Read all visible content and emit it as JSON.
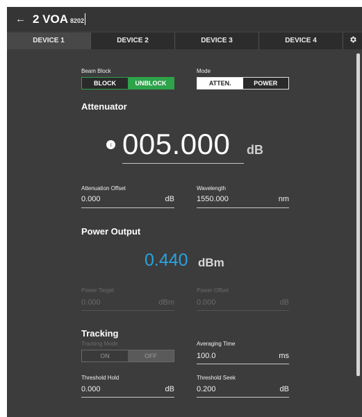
{
  "window": {
    "back_icon": "←",
    "title_main": "2 VOA",
    "title_sub": "8202"
  },
  "tabs": {
    "items": [
      "DEVICE 1",
      "DEVICE 2",
      "DEVICE 3",
      "DEVICE 4"
    ],
    "active": "DEVICE 1",
    "settings_icon": "gear-icon"
  },
  "beam_block": {
    "label": "Beam Block",
    "options": [
      "BLOCK",
      "UNBLOCK"
    ],
    "selected": "UNBLOCK",
    "accent": "#2da34a"
  },
  "mode": {
    "label": "Mode",
    "options": [
      "ATTEN.",
      "POWER"
    ],
    "selected": "ATTEN."
  },
  "attenuator": {
    "heading": "Attenuator",
    "value": "005.000",
    "unit": "dB",
    "info_icon": "↕"
  },
  "attenuation_offset": {
    "label": "Attenuation Offset",
    "value": "0.000",
    "unit": "dB"
  },
  "wavelength": {
    "label": "Wavelength",
    "value": "1550.000",
    "unit": "nm"
  },
  "power_output": {
    "heading": "Power Output",
    "value": "0.440",
    "unit": "dBm",
    "color": "#29a3e0"
  },
  "power_target": {
    "label": "Power Target",
    "value": "0.000",
    "unit": "dBm"
  },
  "power_offset": {
    "label": "Power Offset",
    "value": "0.000",
    "unit": "dB"
  },
  "tracking": {
    "heading": "Tracking",
    "mode_label": "Tracking Mode",
    "options": [
      "ON",
      "OFF"
    ],
    "selected": "OFF"
  },
  "averaging_time": {
    "label": "Averaging Time",
    "value": "100.0",
    "unit": "ms"
  },
  "threshold_hold": {
    "label": "Threshold Hold",
    "value": "0.000",
    "unit": "dB"
  },
  "threshold_seek": {
    "label": "Threshold Seek",
    "value": "0.200",
    "unit": "dB"
  }
}
